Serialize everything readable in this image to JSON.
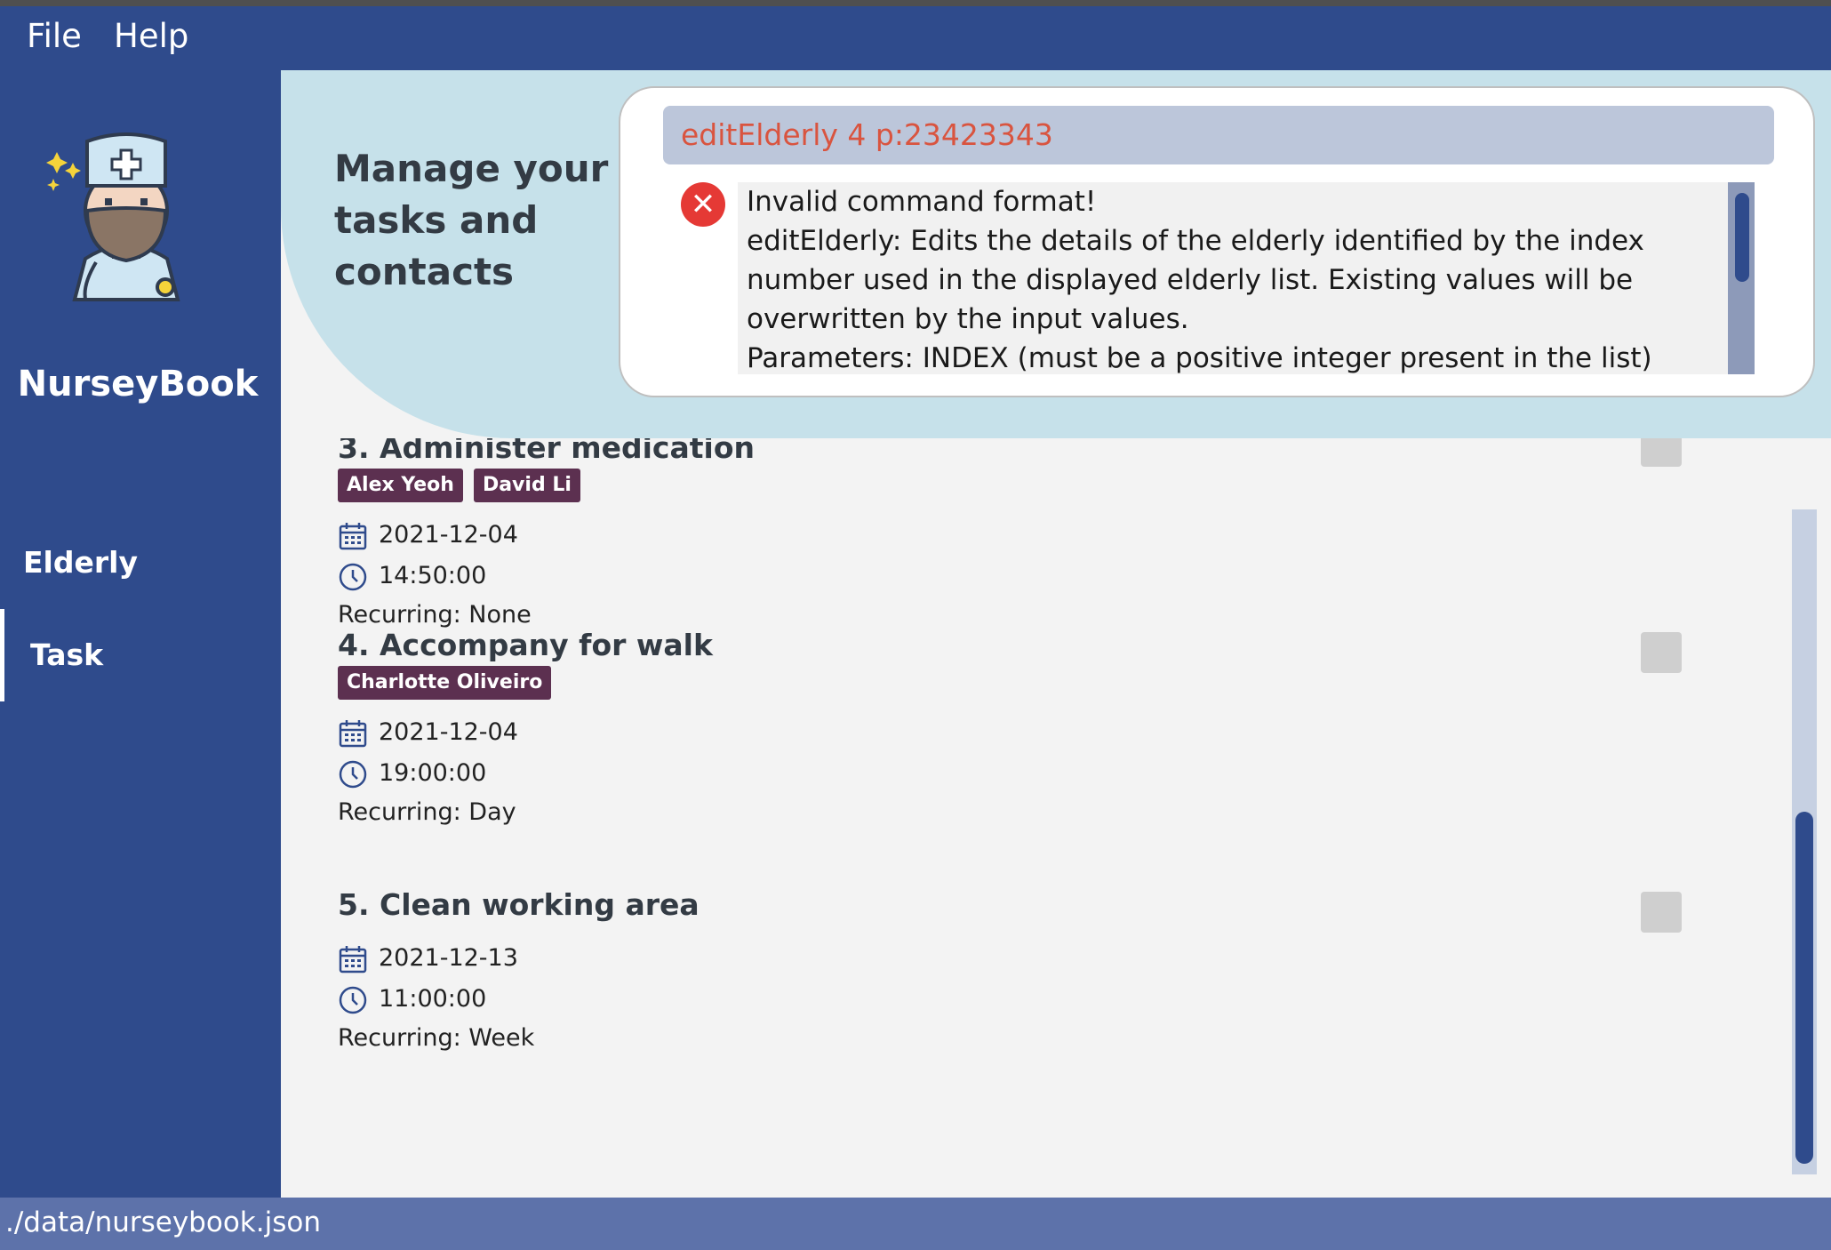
{
  "menu": {
    "file": "File",
    "help": "Help"
  },
  "sidebar": {
    "brand": "NurseyBook",
    "items": [
      {
        "label": "Elderly"
      },
      {
        "label": "Task"
      }
    ],
    "active": "Task"
  },
  "header": {
    "tagline": "Manage your tasks and contacts"
  },
  "command": {
    "input_value": "editElderly 4 p:23423343",
    "result_lines": [
      "Invalid command format!",
      "editElderly: Edits the details of the elderly identified by the index number used in the displayed elderly list. Existing values will be overwritten by the input values.",
      "Parameters: INDEX (must be a positive integer present in the list)"
    ]
  },
  "tasks": [
    {
      "title": "3. Administer medication",
      "tags": [
        "Alex Yeoh",
        "David Li"
      ],
      "date": "2021-12-04",
      "time": "14:50:00",
      "recurring": "Recurring: None"
    },
    {
      "title": "4. Accompany for walk",
      "tags": [
        "Charlotte Oliveiro"
      ],
      "date": "2021-12-04",
      "time": "19:00:00",
      "recurring": "Recurring: Day"
    },
    {
      "title": "5. Clean working area",
      "tags": [],
      "date": "2021-12-13",
      "time": "11:00:00",
      "recurring": "Recurring: Week"
    }
  ],
  "status": {
    "path": "./data/nurseybook.json"
  },
  "colors": {
    "primary": "#2f4b8c",
    "banner": "#c6e1ea",
    "tag": "#5c3050",
    "error": "#e53935",
    "error_text": "#d9543f",
    "status_bar": "#5d72aa"
  }
}
